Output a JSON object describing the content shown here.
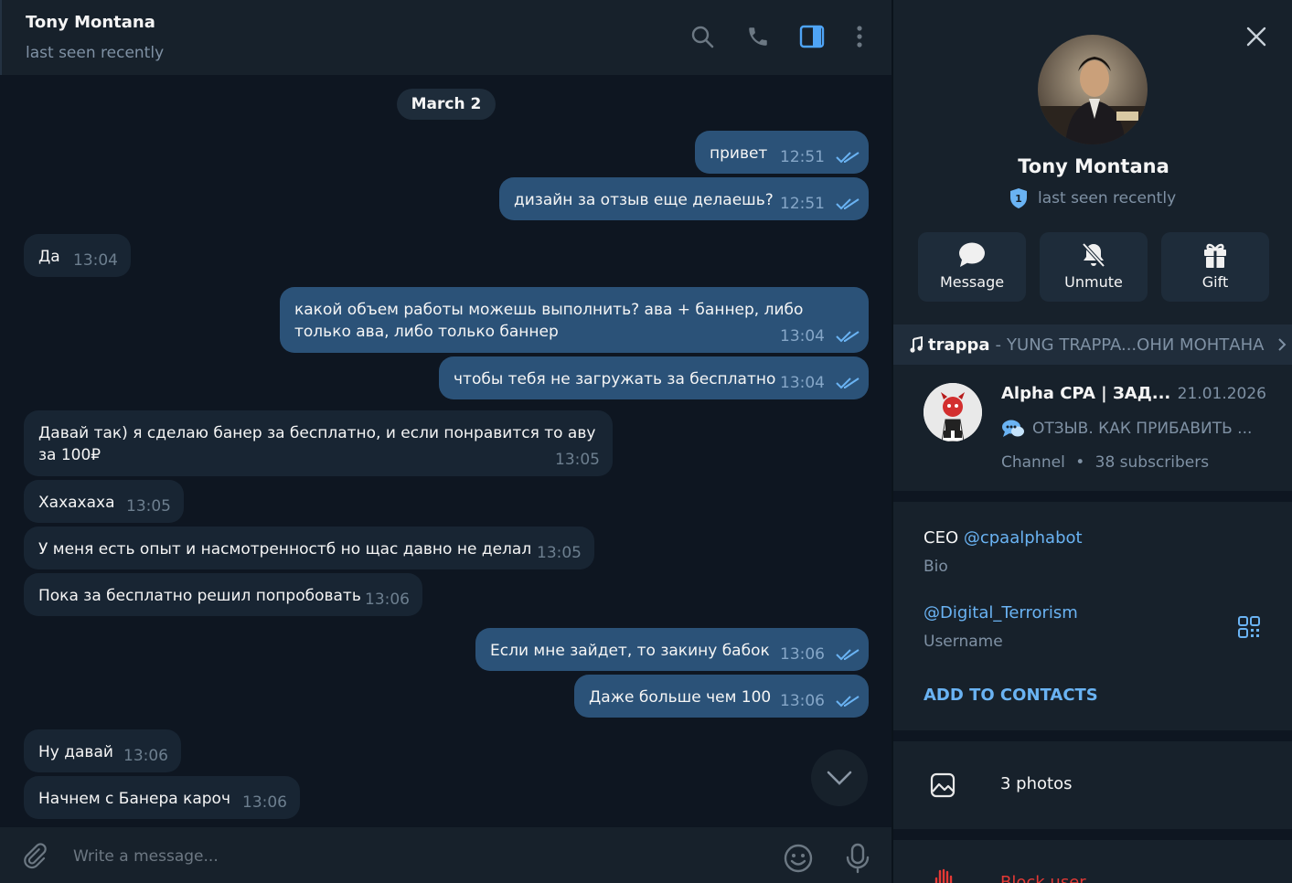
{
  "chat": {
    "name": "Tony Montana",
    "status": "last seen recently",
    "date_divider": "March 2",
    "messages": [
      {
        "dir": "out",
        "text": "привет",
        "time": "12:51"
      },
      {
        "dir": "out",
        "text": "дизайн за отзыв еще делаешь?",
        "time": "12:51"
      },
      {
        "dir": "in",
        "text": "Да",
        "time": "13:04"
      },
      {
        "dir": "out",
        "text": "какой объем работы можешь выполнить? ава + баннер, либо только ава, либо только баннер",
        "time": "13:04"
      },
      {
        "dir": "out",
        "text": "чтобы тебя не загружать за бесплатно",
        "time": "13:04"
      },
      {
        "dir": "in",
        "text": "Давай так) я сделаю банер за бесплатно, и если понравится то аву за 100₽",
        "time": "13:05"
      },
      {
        "dir": "in",
        "text": "Хахахаха",
        "time": "13:05"
      },
      {
        "dir": "in",
        "text": "У меня есть опыт и насмотренностб но щас давно не делал",
        "time": "13:05"
      },
      {
        "dir": "in",
        "text": "Пока за бесплатно решил попробовать",
        "time": "13:06"
      },
      {
        "dir": "out",
        "text": "Если мне зайдет, то закину бабок",
        "time": "13:06"
      },
      {
        "dir": "out",
        "text": "Даже больше чем 100",
        "time": "13:06"
      },
      {
        "dir": "in",
        "text": "Ну давай",
        "time": "13:06"
      },
      {
        "dir": "in",
        "text": "Начнем с Банера кароч",
        "time": "13:06"
      }
    ],
    "composer_placeholder": "Write a message..."
  },
  "profile": {
    "name": "Tony Montana",
    "status": "last seen recently",
    "status_badge": "1",
    "actions": [
      {
        "label": "Message",
        "icon": "chat-bubble-icon"
      },
      {
        "label": "Unmute",
        "icon": "bell-off-icon"
      },
      {
        "label": "Gift",
        "icon": "gift-icon"
      }
    ],
    "music": {
      "title": "trappa",
      "separator": "-",
      "artist": "YUNG TRAPPA...ОНИ МОНТАНА"
    },
    "channel": {
      "name": "Alpha CPA | ЗАД...",
      "date": "21.01.2026",
      "post": "ОТЗЫВ. КАК ПРИБАВИТЬ ...",
      "type": "Channel",
      "subscribers": "38 subscribers"
    },
    "bio": {
      "prefix": "CEO ",
      "handle": "@cpaalphabot",
      "label": "Bio"
    },
    "username": {
      "value": "@Digital_Terrorism",
      "label": "Username"
    },
    "add_contacts": "ADD TO CONTACTS",
    "photos": "3 photos",
    "block": "Block user"
  },
  "colors": {
    "bg": "#0e1621",
    "panel": "#17212b",
    "outgoing": "#2b5278",
    "incoming": "#182533",
    "accent": "#6ab3f3",
    "danger": "#e53935"
  }
}
